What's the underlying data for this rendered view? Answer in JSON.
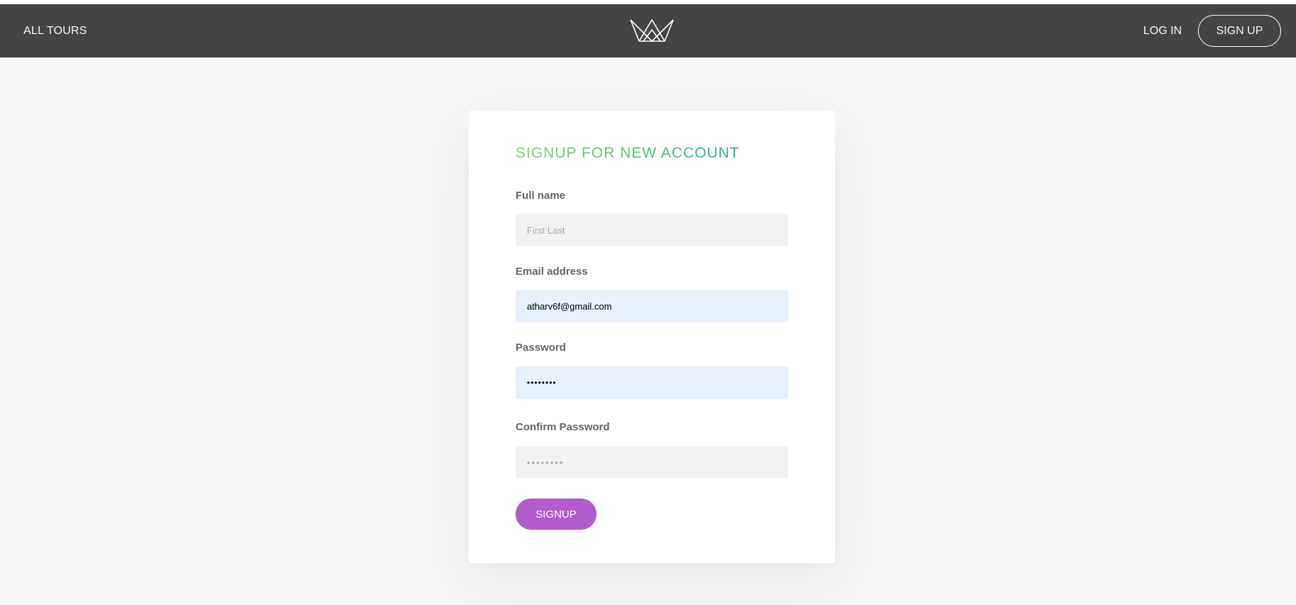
{
  "nav": {
    "all_tours": "ALL TOURS",
    "login": "LOG IN",
    "signup": "SIGN UP"
  },
  "form": {
    "title": "SIGNUP FOR NEW ACCOUNT",
    "fields": [
      {
        "label": "Full name",
        "value": "",
        "placeholder": "First Last"
      },
      {
        "label": "Email address",
        "value": "atharv6f@gmail.com",
        "placeholder": ""
      },
      {
        "label": "Password",
        "value": "••••••••",
        "placeholder": ""
      },
      {
        "label": "Confirm Password",
        "value": "",
        "placeholder": "••••••••"
      }
    ],
    "submit_label": "SIGNUP"
  },
  "icons": {
    "logo": "crown-logo-icon"
  },
  "colors": {
    "header_bg": "#444444",
    "page_bg": "#f7f7f7",
    "accent_green_start": "#7dd56f",
    "accent_green_end": "#28b487",
    "button_purple": "#b15bcc",
    "autofill_bg": "#e8f0fe"
  }
}
